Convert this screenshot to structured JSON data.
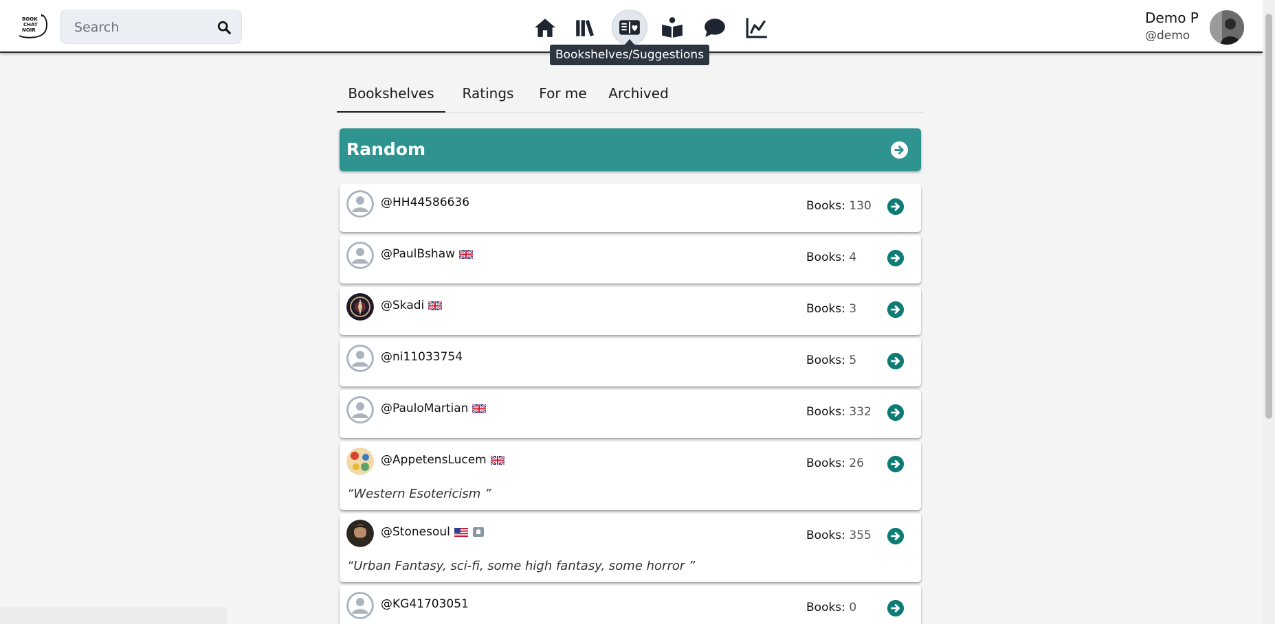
{
  "header": {
    "logo_lines": [
      "BOOK",
      "CHAT",
      "NOIR"
    ],
    "search_placeholder": "Search",
    "nav": [
      {
        "name": "home-icon"
      },
      {
        "name": "library-icon"
      },
      {
        "name": "bookshelves-suggestions-icon",
        "active": true
      },
      {
        "name": "reading-icon"
      },
      {
        "name": "chat-icon"
      },
      {
        "name": "stats-icon"
      }
    ],
    "tooltip": "Bookshelves/Suggestions",
    "user": {
      "name": "Demo P",
      "handle": "@demo"
    }
  },
  "tabs": [
    {
      "label": "Bookshelves",
      "active": true
    },
    {
      "label": "Ratings"
    },
    {
      "label": "For me"
    },
    {
      "label": "Archived"
    }
  ],
  "banner": {
    "title": "Random"
  },
  "books_label": "Books:",
  "users": [
    {
      "handle": "@HH44586636",
      "books": "130",
      "flag": "",
      "bio": "",
      "avatar": "default"
    },
    {
      "handle": "@PaulBshaw",
      "books": "4",
      "flag": "gb",
      "bio": "",
      "avatar": "default"
    },
    {
      "handle": "@Skadi",
      "books": "3",
      "flag": "gb",
      "bio": "",
      "avatar": "emblem"
    },
    {
      "handle": "@ni11033754",
      "books": "5",
      "flag": "",
      "bio": "",
      "avatar": "default"
    },
    {
      "handle": "@PauloMartian",
      "books": "332",
      "flag": "gb",
      "bio": "",
      "avatar": "default"
    },
    {
      "handle": "@AppetensLucem",
      "books": "26",
      "flag": "gb",
      "bio": "“Western Esotericism ”",
      "avatar": "colorful"
    },
    {
      "handle": "@Stonesoul",
      "books": "355",
      "flag": "us",
      "badge": true,
      "bio": "“Urban Fantasy, sci-fi, some high fantasy, some horror ”",
      "avatar": "photo"
    },
    {
      "handle": "@KG41703051",
      "books": "0",
      "flag": "",
      "bio": "",
      "avatar": "default"
    }
  ],
  "colors": {
    "accent": "#2f9490",
    "arrow": "#0f7b74"
  }
}
